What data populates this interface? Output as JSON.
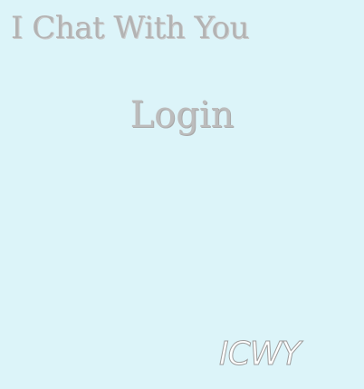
{
  "app": {
    "title": "I Chat With You"
  },
  "page": {
    "heading": "Login"
  },
  "brand": {
    "logo_text": "ICWY"
  },
  "colors": {
    "background": "#dcf4f9",
    "title_text": "#b3b3b3",
    "logo_fill": "#ffffff",
    "logo_stroke": "#9d9d9d"
  }
}
